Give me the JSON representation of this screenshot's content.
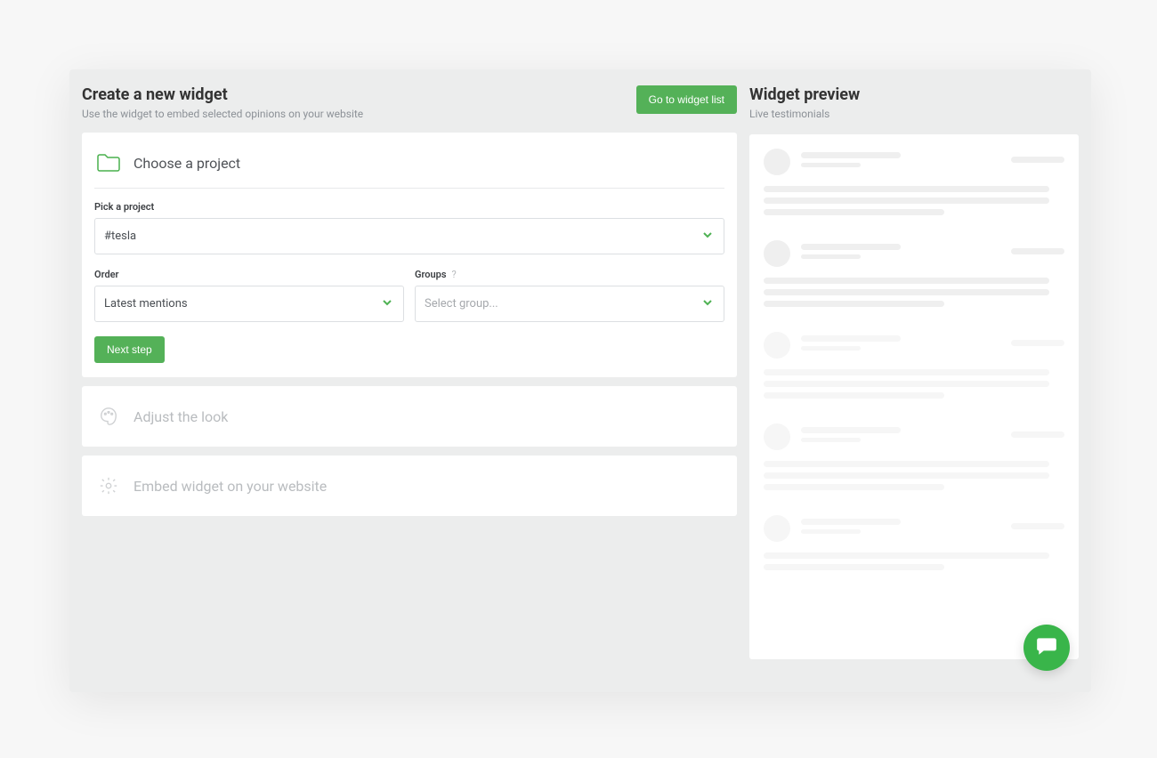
{
  "header": {
    "title": "Create a new widget",
    "subtitle": "Use the widget to embed selected opinions on your website",
    "go_to_list": "Go to widget list"
  },
  "steps": {
    "choose": {
      "title": "Choose a project",
      "pick_label": "Pick a project",
      "project_value": "#tesla",
      "order_label": "Order",
      "order_value": "Latest mentions",
      "groups_label": "Groups",
      "groups_help": "?",
      "groups_placeholder": "Select group...",
      "next": "Next step"
    },
    "adjust": {
      "title": "Adjust the look"
    },
    "embed": {
      "title": "Embed widget on your website"
    }
  },
  "preview": {
    "title": "Widget preview",
    "subtitle": "Live testimonials"
  }
}
